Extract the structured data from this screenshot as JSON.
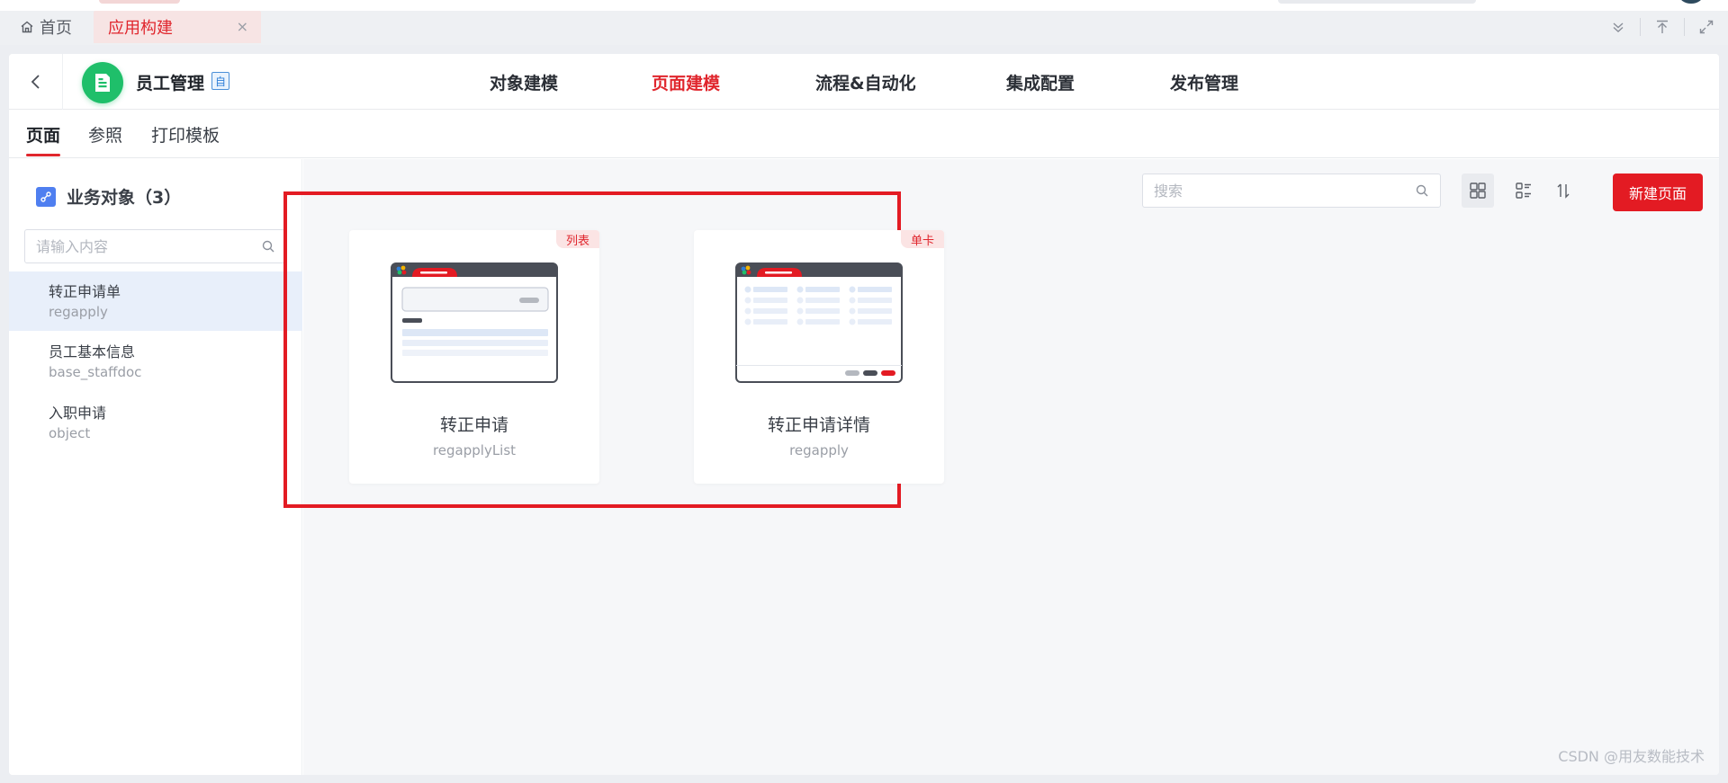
{
  "tabs": {
    "home_label": "首页",
    "app_label": "应用构建",
    "close_glyph": "×"
  },
  "header": {
    "app_name": "员工管理",
    "app_badge": "自",
    "nav": [
      "对象建模",
      "页面建模",
      "流程&自动化",
      "集成配置",
      "发布管理"
    ],
    "active_nav": "页面建模"
  },
  "subtabs": [
    "页面",
    "参照",
    "打印模板"
  ],
  "sidebar": {
    "title": "业务对象（3）",
    "search_placeholder": "请输入内容",
    "items": [
      {
        "name": "转正申请单",
        "code": "regapply"
      },
      {
        "name": "员工基本信息",
        "code": "base_staffdoc"
      },
      {
        "name": "入职申请",
        "code": "object"
      }
    ]
  },
  "toolbar": {
    "search_placeholder": "搜索",
    "new_button": "新建页面"
  },
  "pages": [
    {
      "tag": "列表",
      "title": "转正申请",
      "code": "regapplyList"
    },
    {
      "tag": "单卡",
      "title": "转正申请详情",
      "code": "regapply"
    }
  ],
  "watermark": "CSDN @用友数能技术",
  "colors": {
    "accent": "#e31b23",
    "app_logo": "#1fbf6a",
    "selected_item_bg": "#e8effa"
  }
}
